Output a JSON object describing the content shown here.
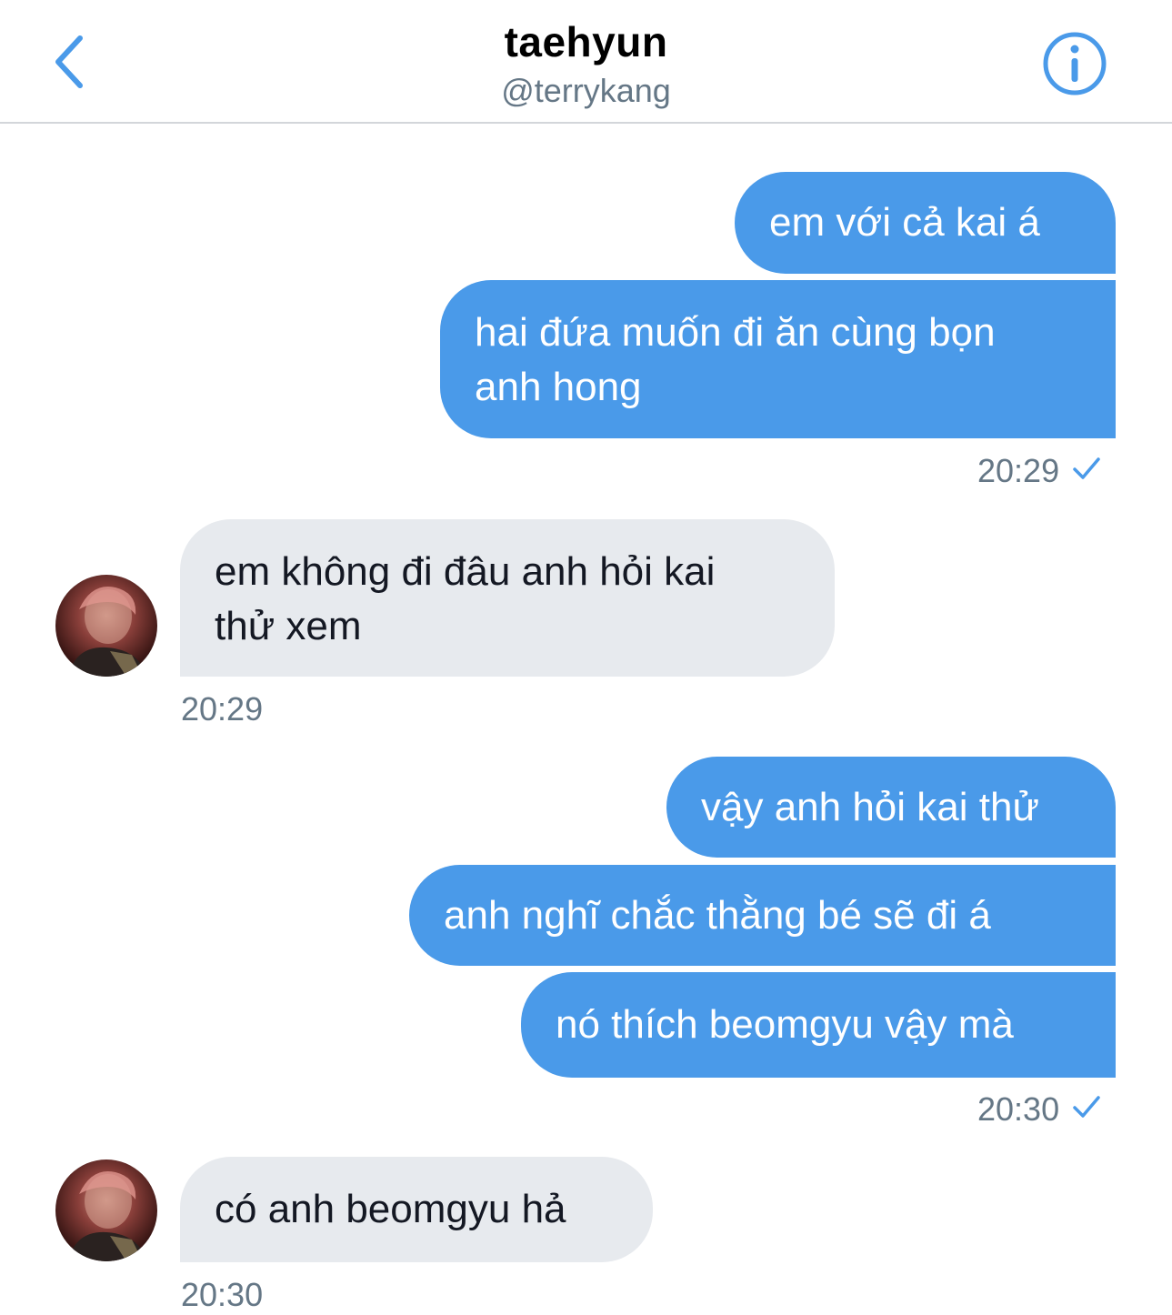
{
  "header": {
    "title": "taehyun",
    "handle": "@terrykang",
    "back_icon": "chevron-left-icon",
    "info_icon": "info-icon",
    "accent_color": "#4a9ae9"
  },
  "messages": [
    {
      "direction": "sent",
      "text": "em với cả kai á"
    },
    {
      "direction": "sent",
      "lines": [
        "hai đứa muốn đi ăn cùng bọn",
        "anh hong"
      ]
    },
    {
      "direction": "received",
      "lines": [
        "em không đi đâu anh hỏi kai",
        "thử xem"
      ]
    },
    {
      "direction": "sent",
      "text": "vậy anh hỏi kai thử"
    },
    {
      "direction": "sent",
      "text": "anh nghĩ chắc thằng bé sẽ đi á"
    },
    {
      "direction": "sent",
      "text": "nó thích beomgyu vậy mà"
    },
    {
      "direction": "received",
      "text": "có anh beomgyu hả"
    }
  ],
  "timestamps": {
    "group1": "20:29",
    "group2": "20:29",
    "group3": "20:30",
    "group4": "20:30"
  },
  "colors": {
    "sent_bubble": "#4a9ae9",
    "received_bubble": "#e7eaee",
    "timestamp_text": "#657786"
  }
}
